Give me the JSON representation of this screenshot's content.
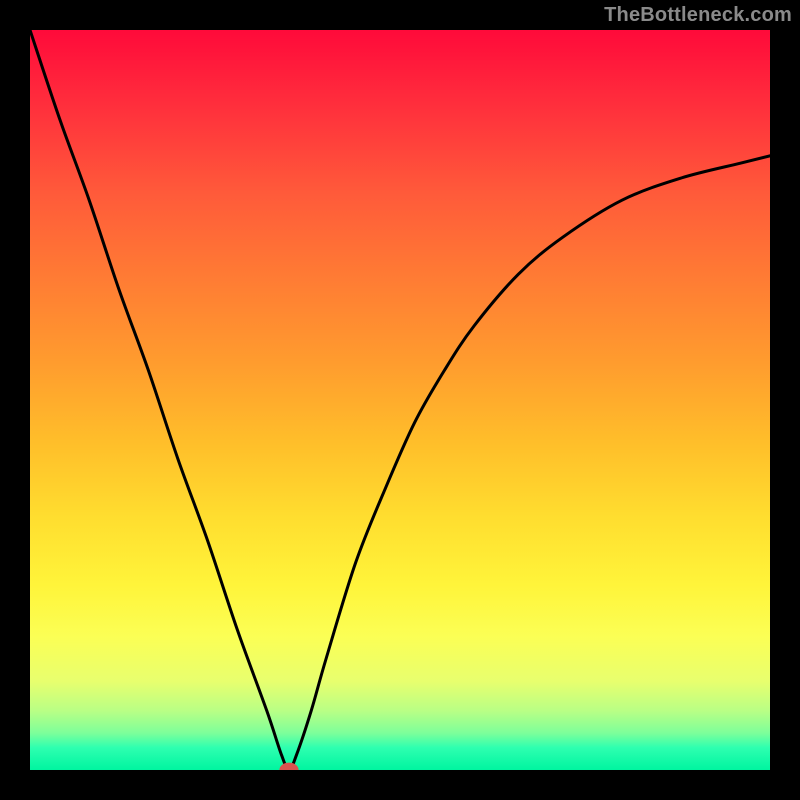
{
  "watermark": "TheBottleneck.com",
  "chart_data": {
    "type": "line",
    "title": "",
    "xlabel": "",
    "ylabel": "",
    "xlim": [
      0,
      100
    ],
    "ylim": [
      0,
      100
    ],
    "grid": false,
    "legend": false,
    "background_gradient": {
      "direction": "vertical",
      "stops": [
        {
          "pos": 0.0,
          "color": "#ff0a3a"
        },
        {
          "pos": 0.1,
          "color": "#ff2e3c"
        },
        {
          "pos": 0.22,
          "color": "#ff5a3a"
        },
        {
          "pos": 0.33,
          "color": "#ff7a34"
        },
        {
          "pos": 0.45,
          "color": "#ff9c2e"
        },
        {
          "pos": 0.56,
          "color": "#ffbf2a"
        },
        {
          "pos": 0.66,
          "color": "#ffde2f"
        },
        {
          "pos": 0.75,
          "color": "#fff43a"
        },
        {
          "pos": 0.82,
          "color": "#fbff55"
        },
        {
          "pos": 0.88,
          "color": "#e8ff6e"
        },
        {
          "pos": 0.92,
          "color": "#b9ff85"
        },
        {
          "pos": 0.95,
          "color": "#7dff9a"
        },
        {
          "pos": 0.97,
          "color": "#2dffb0"
        },
        {
          "pos": 1.0,
          "color": "#00f5a0"
        }
      ]
    },
    "series": [
      {
        "name": "bottleneck-curve",
        "color": "#000000",
        "x": [
          0,
          4,
          8,
          12,
          16,
          20,
          24,
          28,
          32,
          34,
          35,
          36,
          38,
          40,
          44,
          48,
          52,
          56,
          60,
          66,
          72,
          80,
          88,
          96,
          100
        ],
        "y": [
          100,
          88,
          77,
          65,
          54,
          42,
          31,
          19,
          8,
          2,
          0,
          2,
          8,
          15,
          28,
          38,
          47,
          54,
          60,
          67,
          72,
          77,
          80,
          82,
          83
        ]
      }
    ],
    "marker": {
      "x": 35,
      "y": 0,
      "rx": 1.3,
      "ry": 1.0,
      "color": "#d9534f"
    }
  }
}
